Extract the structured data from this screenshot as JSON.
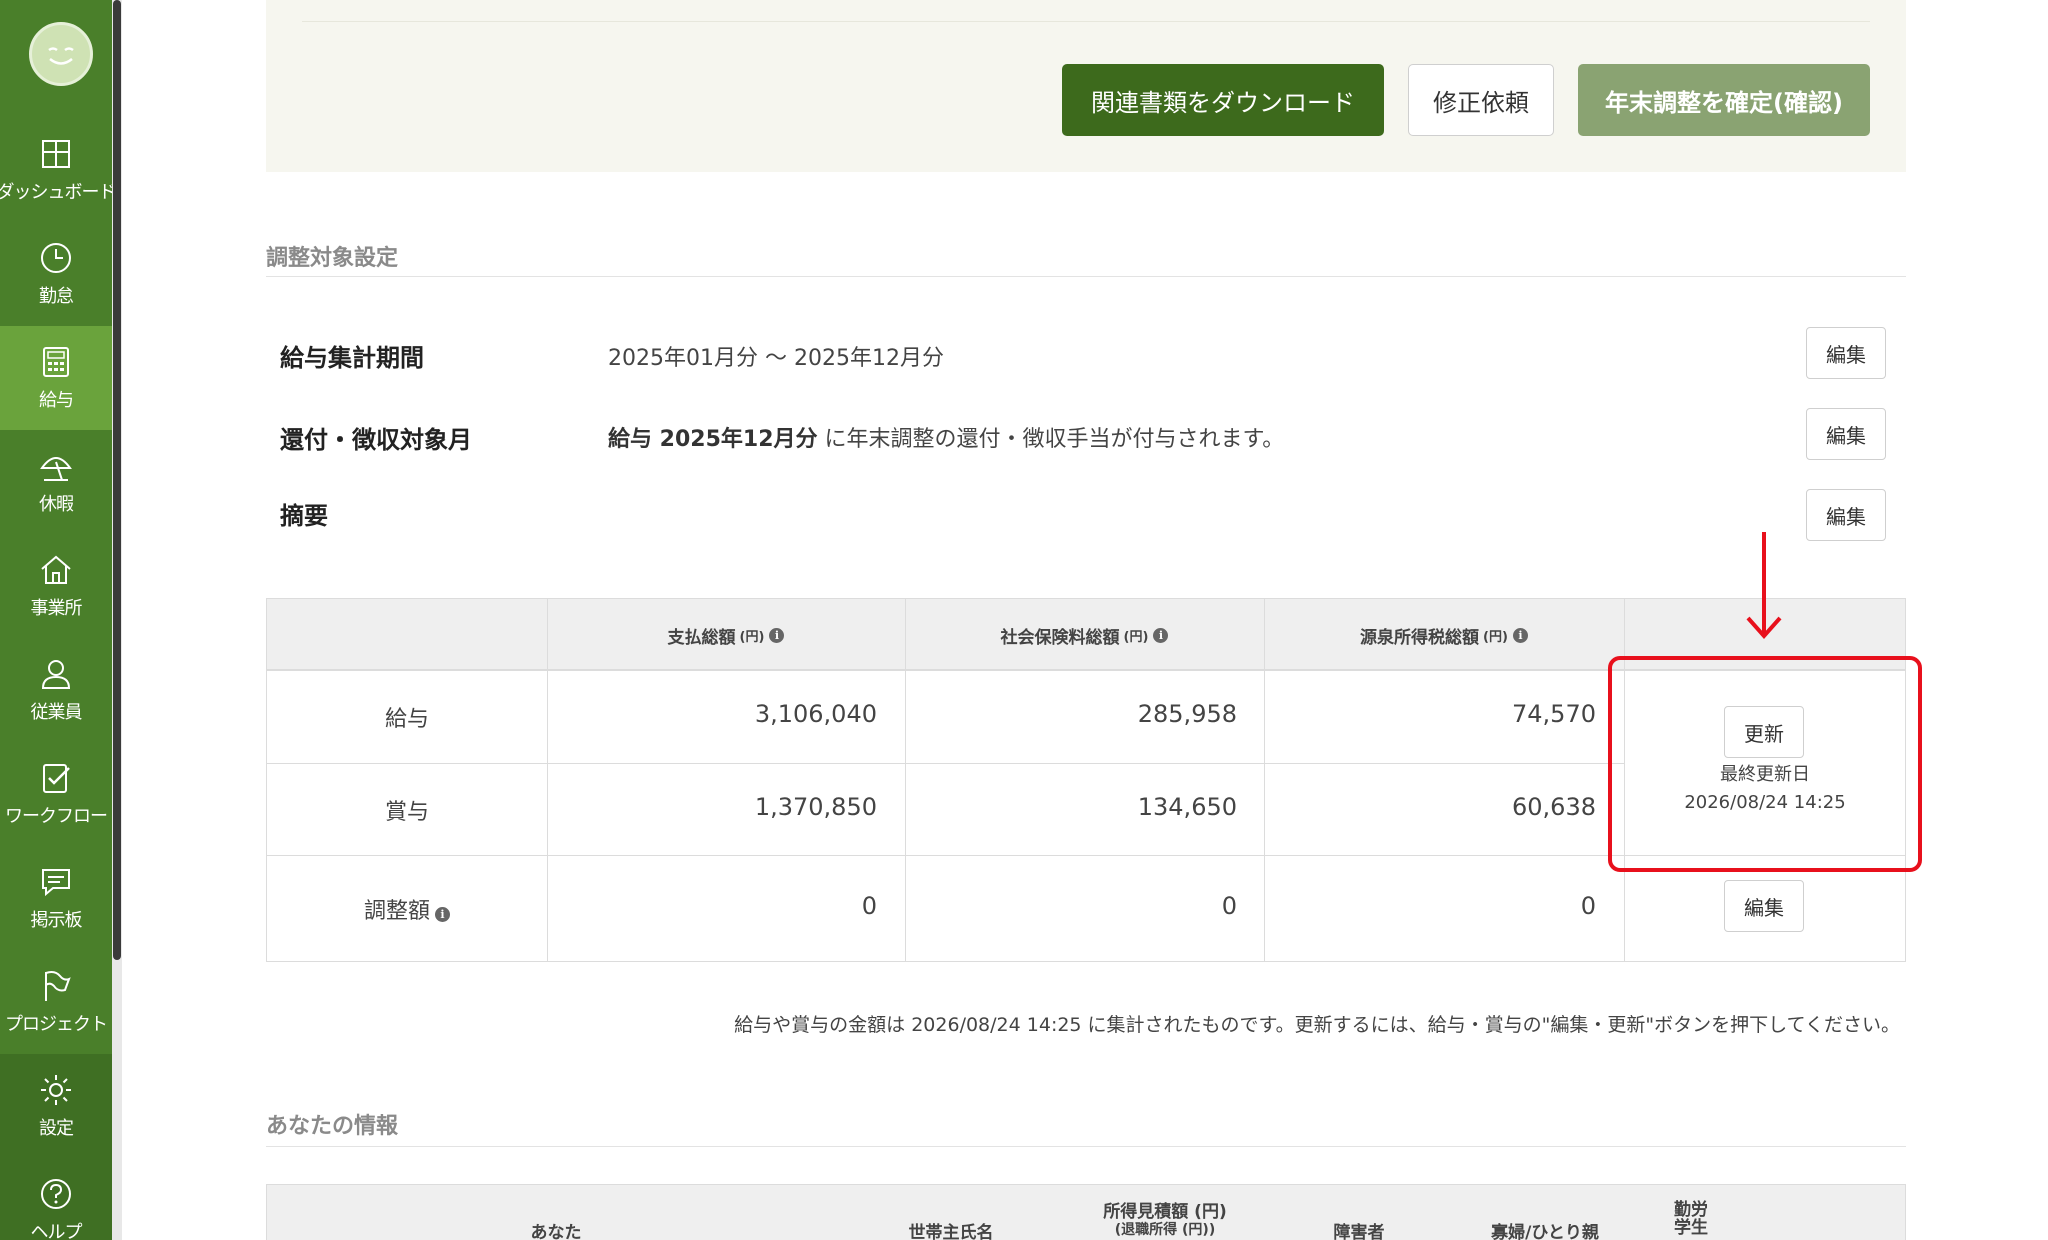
{
  "sidebar": {
    "items": [
      {
        "label": "ダッシュボード",
        "icon": "dashboard-icon"
      },
      {
        "label": "勤怠",
        "icon": "clock-icon"
      },
      {
        "label": "給与",
        "icon": "calculator-icon"
      },
      {
        "label": "休暇",
        "icon": "umbrella-icon"
      },
      {
        "label": "事業所",
        "icon": "home-icon"
      },
      {
        "label": "従業員",
        "icon": "person-icon"
      },
      {
        "label": "ワークフロー",
        "icon": "checklist-icon"
      },
      {
        "label": "掲示板",
        "icon": "chat-icon"
      },
      {
        "label": "プロジェクト",
        "icon": "flag-icon"
      },
      {
        "label": "設定",
        "icon": "gear-icon"
      },
      {
        "label": "ヘルプ",
        "icon": "help-icon"
      }
    ],
    "active": "給与"
  },
  "actions": {
    "download": "関連書類をダウンロード",
    "request_fix": "修正依頼",
    "confirm": "年末調整を確定(確認)"
  },
  "settings": {
    "section_title": "調整対象設定",
    "rows": [
      {
        "label": "給与集計期間",
        "value": "2025年01月分 〜 2025年12月分",
        "edit": "編集"
      },
      {
        "label": "還付・徴収対象月",
        "value_bold": "給与 2025年12月分",
        "value": " に年末調整の還付・徴収手当が付与されます。",
        "edit": "編集"
      },
      {
        "label": "摘要",
        "value": "",
        "edit": "編集"
      }
    ]
  },
  "totals": {
    "columns": [
      {
        "label": "支払総額",
        "unit": "(円)"
      },
      {
        "label": "社会保険料総額",
        "unit": "(円)"
      },
      {
        "label": "源泉所得税総額",
        "unit": "(円)"
      }
    ],
    "rows": [
      {
        "label": "給与",
        "values": [
          "3,106,040",
          "285,958",
          "74,570"
        ]
      },
      {
        "label": "賞与",
        "values": [
          "1,370,850",
          "134,650",
          "60,638"
        ]
      },
      {
        "label": "調整額",
        "values": [
          "0",
          "0",
          "0"
        ]
      }
    ],
    "update_button": "更新",
    "last_updated_label": "最終更新日",
    "last_updated": "2026/08/24 14:25",
    "adjust_edit": "編集",
    "info_glyph": "i"
  },
  "note": "給与や賞与の金額は 2026/08/24 14:25 に集計されたものです。更新するには、給与・賞与の\"編集・更新\"ボタンを押下してください。",
  "your_info": {
    "section_title": "あなたの情報",
    "columns": [
      "あなた",
      "世帯主氏名",
      "所得見積額 (円)",
      "(退職所得 (円))",
      "障害者",
      "寡婦/ひとり親",
      "勤労",
      "学生"
    ]
  }
}
